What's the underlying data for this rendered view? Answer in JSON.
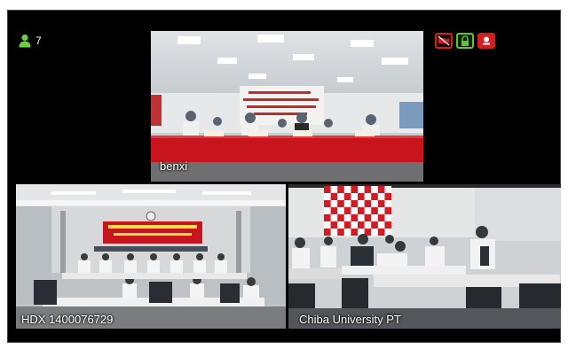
{
  "participants": {
    "icon": "person-icon",
    "count": "7"
  },
  "controls": [
    {
      "name": "camera-off-icon",
      "color": "#d21e1e"
    },
    {
      "name": "lock-icon",
      "color": "#5fc23a"
    },
    {
      "name": "record-icon",
      "color": "#d21e1e"
    }
  ],
  "tiles": {
    "top": {
      "label": "benxi"
    },
    "bottom_left": {
      "label": "HDX 1400076729"
    },
    "bottom_right": {
      "label": "Chiba University PT"
    }
  }
}
